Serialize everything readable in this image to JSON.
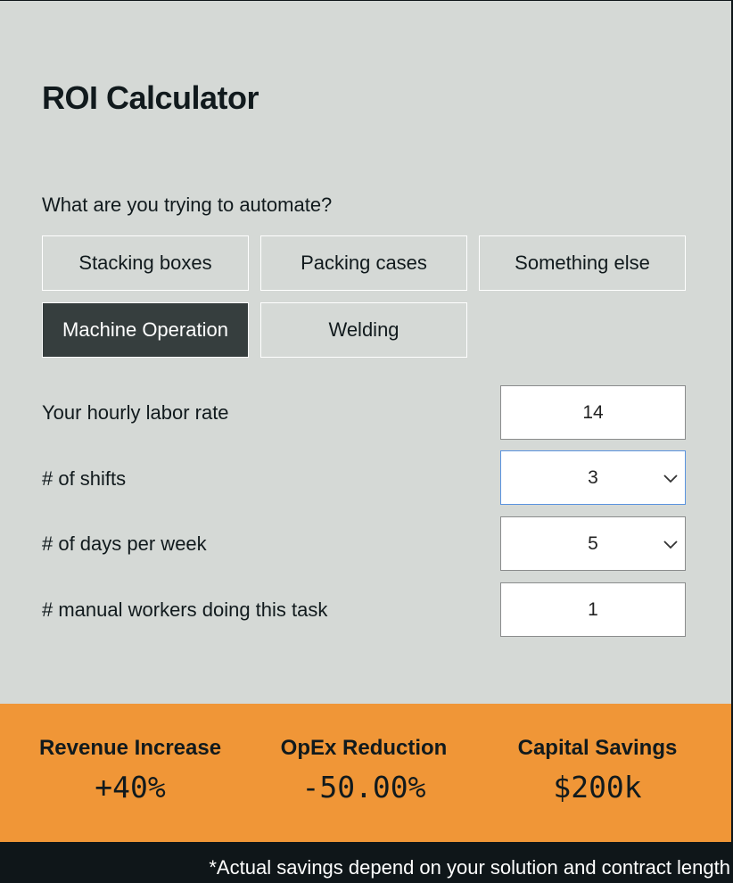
{
  "title": "ROI Calculator",
  "question": "What are you trying to automate?",
  "options": [
    {
      "label": "Stacking boxes",
      "selected": false
    },
    {
      "label": "Packing cases",
      "selected": false
    },
    {
      "label": "Something else",
      "selected": false
    },
    {
      "label": "Machine Operation",
      "selected": true
    },
    {
      "label": "Welding",
      "selected": false
    }
  ],
  "fields": [
    {
      "label": "Your hourly labor rate",
      "value": "14",
      "type": "input"
    },
    {
      "label": "# of shifts",
      "value": "3",
      "type": "select",
      "icon": "chevron-down-icon"
    },
    {
      "label": "# of days per week",
      "value": "5",
      "type": "select",
      "icon": "chevron-down-icon"
    },
    {
      "label": "# manual workers doing this task",
      "value": "1",
      "type": "input"
    }
  ],
  "results": [
    {
      "label": "Revenue Increase",
      "value": "+40%"
    },
    {
      "label": "OpEx Reduction",
      "value": "-50.00%"
    },
    {
      "label": "Capital Savings",
      "value": "$200k"
    }
  ],
  "footnote": "*Actual savings depend on your solution and contract length",
  "colors": {
    "background": "#d5d9d6",
    "accent": "#f09637",
    "selected": "#363e3e",
    "dark": "#0f1619",
    "focus": "#5a93de"
  }
}
